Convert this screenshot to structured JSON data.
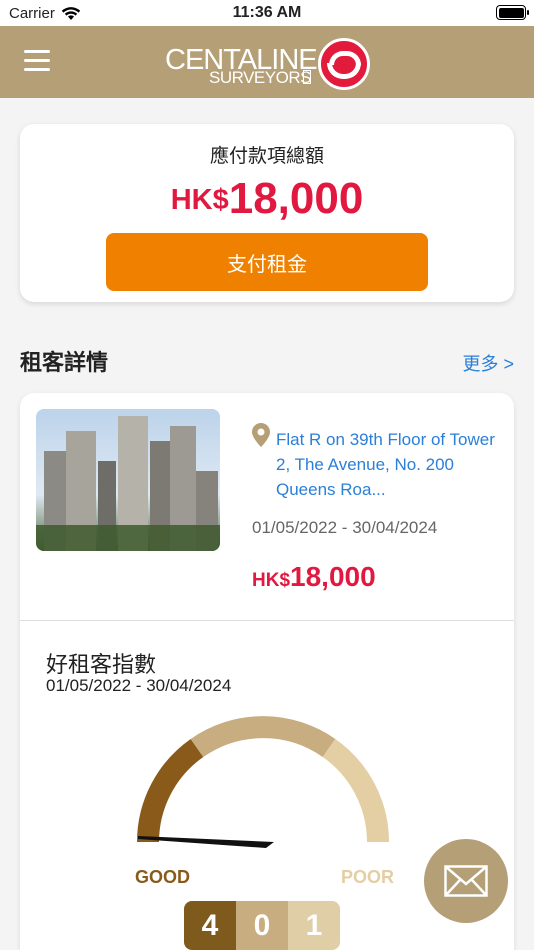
{
  "status_bar": {
    "carrier": "Carrier",
    "time": "11:36 AM"
  },
  "header": {
    "logo_line1": "CENTALINE",
    "logo_line2": "SURVEYORS",
    "brand_color": "#b59f76",
    "logo_mark_color": "#e21a3c"
  },
  "payment": {
    "title": "應付款項總額",
    "currency": "HK$",
    "amount": "18,000",
    "pay_button_label": "支付租金",
    "accent_color": "#e1183f",
    "button_color": "#f08100"
  },
  "tenant_section": {
    "title": "租客詳情",
    "more_link": "更多 >"
  },
  "tenancy": {
    "address": "Flat R on 39th Floor of Tower 2, The Avenue, No. 200 Queens Roa...",
    "period": "01/05/2022 - 30/04/2024",
    "rent_currency": "HK$",
    "rent_amount": "18,000"
  },
  "tenant_score": {
    "title": "好租客指數",
    "period": "01/05/2022 - 30/04/2024",
    "good_label": "GOOD",
    "poor_label": "POOR",
    "digits": [
      "4",
      "0",
      "1"
    ]
  },
  "icons": {
    "menu": "menu-icon",
    "location": "location-pin-icon",
    "mail": "mail-icon",
    "wifi": "wifi-icon",
    "battery": "battery-icon"
  }
}
